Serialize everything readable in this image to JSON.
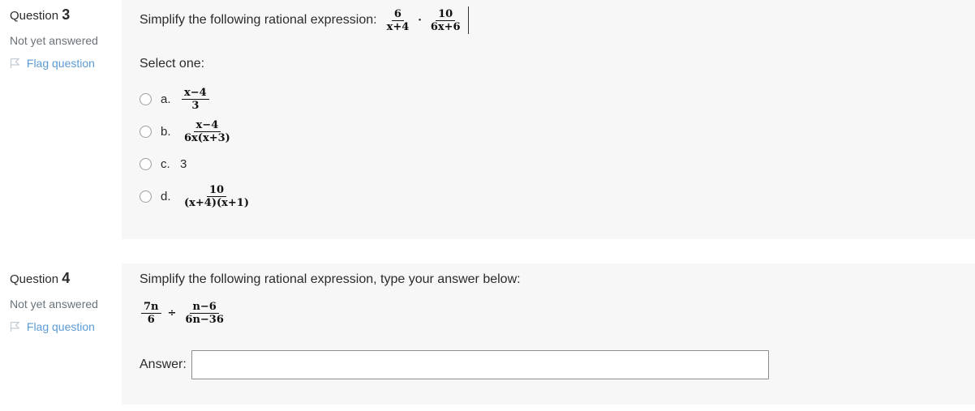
{
  "questions": [
    {
      "number_label": "Question",
      "number": "3",
      "state": "Not yet answered",
      "flag_label": "Flag question",
      "flag_icon": "flag-icon",
      "prompt": "Simplify the following rational expression:",
      "expression": {
        "terms": [
          {
            "numerator": "6",
            "denominator": "x+4"
          },
          {
            "numerator": "10",
            "denominator": "6x+6"
          }
        ],
        "operator": "·"
      },
      "select_instruction": "Select one:",
      "options": [
        {
          "letter": "a.",
          "type": "fraction",
          "numerator": "x−4",
          "denominator": "3"
        },
        {
          "letter": "b.",
          "type": "fraction",
          "numerator": "x−4",
          "denominator": "6x(x+3)"
        },
        {
          "letter": "c.",
          "type": "plain",
          "value": "3"
        },
        {
          "letter": "d.",
          "type": "fraction",
          "numerator": "10",
          "denominator": "(x+4)(x+1)"
        }
      ]
    },
    {
      "number_label": "Question",
      "number": "4",
      "state": "Not yet answered",
      "flag_label": "Flag question",
      "flag_icon": "flag-icon",
      "prompt": "Simplify the following rational expression, type your answer below:",
      "expression": {
        "terms": [
          {
            "numerator": "7n",
            "denominator": "6"
          },
          {
            "numerator": "n−6",
            "denominator": "6n−36"
          }
        ],
        "operator": "÷"
      },
      "answer_label": "Answer:",
      "answer_value": "",
      "answer_placeholder": ""
    }
  ],
  "colors": {
    "panel_background": "#f7f7f7",
    "page_background": "#ffffff",
    "link": "#5b9ad5",
    "muted_text": "#6a737b",
    "body_text": "#2b2b2b",
    "input_border": "#8a8f94"
  }
}
